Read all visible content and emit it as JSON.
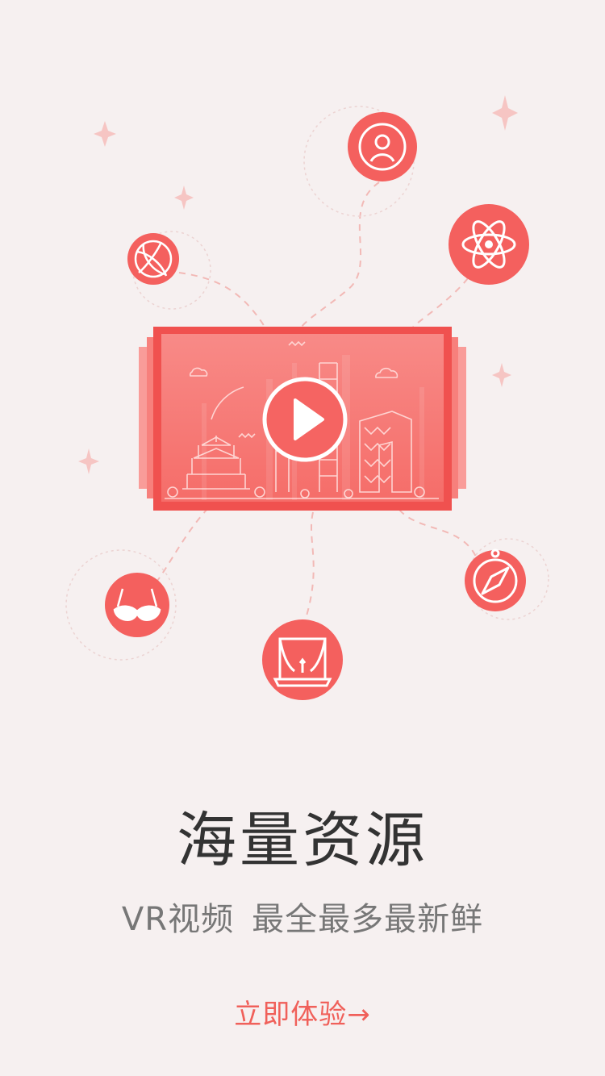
{
  "illustration": {
    "accent_color": "#f56a66",
    "icons": [
      "user-icon",
      "atom-icon",
      "basketball-icon",
      "bra-icon",
      "curtain-icon",
      "compass-icon",
      "play-icon"
    ]
  },
  "headline": "海量资源",
  "subtitle": {
    "left": "VR视频",
    "right": "最全最多最新鲜"
  },
  "cta": {
    "label": "立即体验",
    "arrow": "→"
  }
}
